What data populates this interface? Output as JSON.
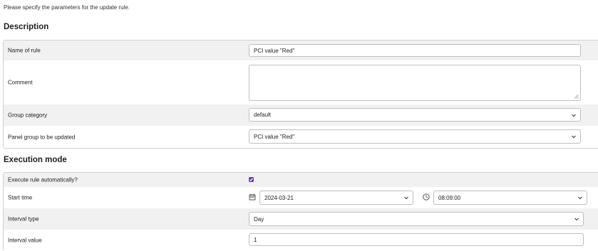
{
  "intro_text": "Please specify the parameters for the update rule.",
  "description": {
    "title": "Description",
    "name_of_rule": {
      "label": "Name of rule",
      "value": "PCI value \"Red\""
    },
    "comment": {
      "label": "Comment",
      "value": ""
    },
    "group_category": {
      "label": "Group category",
      "value": "default"
    },
    "panel_group": {
      "label": "Panel group to be updated",
      "value": "PCI value \"Red\""
    }
  },
  "execution": {
    "title": "Execution mode",
    "auto": {
      "label": "Execute rule automatically?",
      "checked": true
    },
    "start_time": {
      "label": "Start time",
      "date": "2024-03-21",
      "time": "08:09:00"
    },
    "interval_type": {
      "label": "Interval type",
      "value": "Day"
    },
    "interval_value": {
      "label": "Interval value",
      "value": "1"
    }
  },
  "colors": {
    "accent": "#6a3fb5",
    "row_shade": "#f1f1f1",
    "border": "#cfcfcf"
  },
  "icons": {
    "select_arrow": "chevron-down-icon",
    "calendar": "calendar-icon",
    "clock": "clock-icon",
    "checkbox_check": "check-icon",
    "textarea_resize": "resize-grip-icon"
  }
}
